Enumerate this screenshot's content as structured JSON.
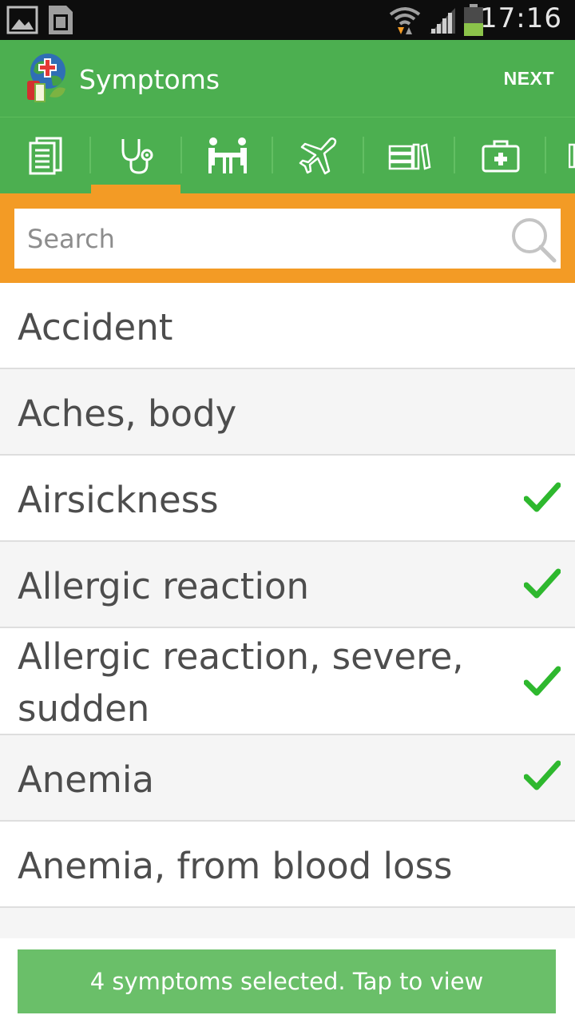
{
  "status_bar": {
    "time": "17:16",
    "icons": [
      "image-icon",
      "sd-card-icon",
      "wifi-icon",
      "signal-icon",
      "battery-icon"
    ]
  },
  "app_bar": {
    "title": "Symptoms",
    "next_label": "NEXT",
    "logo": "app-logo-globe-icon"
  },
  "tabs": [
    {
      "icon": "document-icon",
      "active": false
    },
    {
      "icon": "stethoscope-icon",
      "active": true
    },
    {
      "icon": "consultation-icon",
      "active": false
    },
    {
      "icon": "airplane-icon",
      "active": false
    },
    {
      "icon": "books-icon",
      "active": false
    },
    {
      "icon": "medical-kit-icon",
      "active": false
    }
  ],
  "search": {
    "placeholder": "Search"
  },
  "symptoms": [
    {
      "label": "Accident",
      "selected": false
    },
    {
      "label": "Aches, body",
      "selected": false
    },
    {
      "label": "Airsickness",
      "selected": true
    },
    {
      "label": "Allergic reaction",
      "selected": true
    },
    {
      "label": "Allergic reaction, severe,",
      "label2": "sudden",
      "selected": true
    },
    {
      "label": "Anemia",
      "selected": true
    },
    {
      "label": "Anemia, from blood loss",
      "selected": false
    }
  ],
  "toast": {
    "text": "4 symptoms selected. Tap to view"
  },
  "colors": {
    "primary_green": "#4caf50",
    "accent_orange": "#f39b25",
    "check_green": "#2eb82e",
    "toast_green": "#6abf69"
  }
}
